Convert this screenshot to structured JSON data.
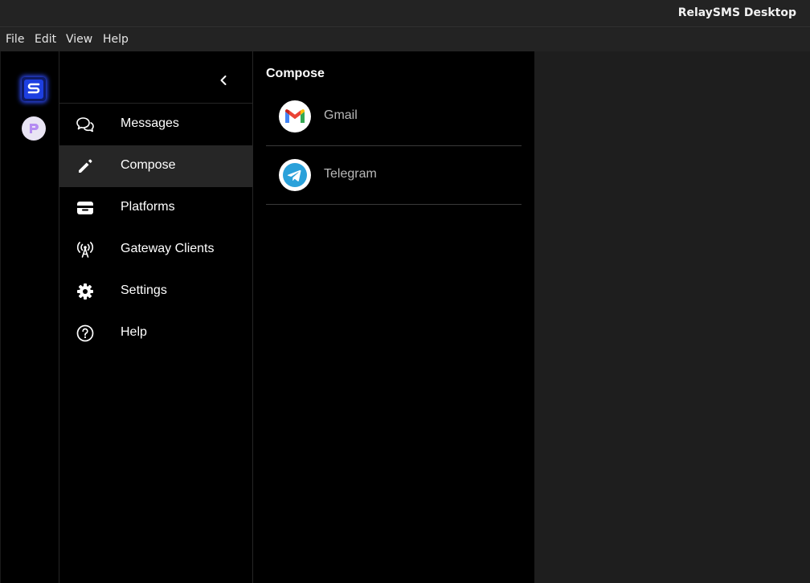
{
  "window": {
    "title": "RelaySMS Desktop"
  },
  "menubar": {
    "items": [
      "File",
      "Edit",
      "View",
      "Help"
    ]
  },
  "drawer": {
    "items": [
      {
        "label": "Messages",
        "icon": "chat-bubbles-icon"
      },
      {
        "label": "Compose",
        "icon": "pencil-icon",
        "active": true
      },
      {
        "label": "Platforms",
        "icon": "wallet-icon"
      },
      {
        "label": "Gateway Clients",
        "icon": "antenna-icon"
      },
      {
        "label": "Settings",
        "icon": "gear-icon"
      },
      {
        "label": "Help",
        "icon": "question-circle-icon"
      }
    ]
  },
  "compose": {
    "heading": "Compose",
    "platforms": [
      {
        "name": "Gmail",
        "icon": "gmail-icon"
      },
      {
        "name": "Telegram",
        "icon": "telegram-icon"
      }
    ]
  },
  "colors": {
    "active_nav_bg": "#262626",
    "accent_glow": "#2e4dff",
    "telegram": "#2aa1da"
  }
}
